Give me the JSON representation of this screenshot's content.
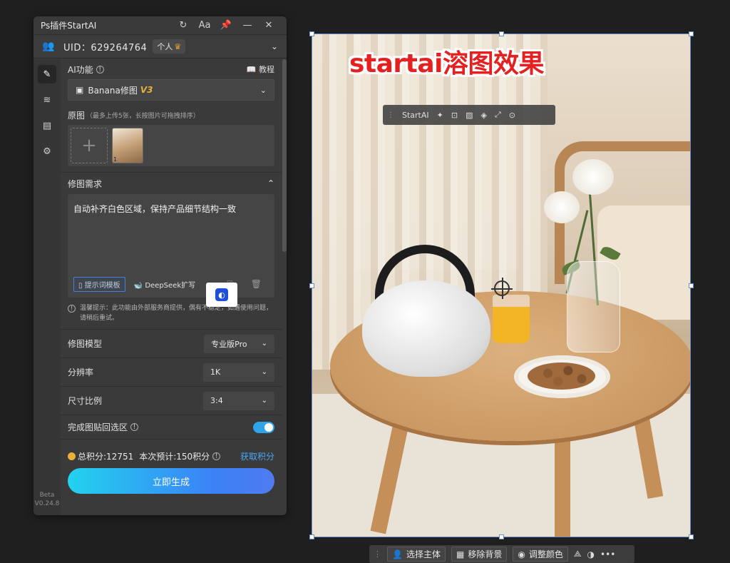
{
  "panel": {
    "title": "Ps插件StartAI",
    "title_icons": [
      "↻",
      "Aa",
      "📌",
      "—",
      "✕"
    ],
    "uid_label": "UID：629264764",
    "user_badge": "个人",
    "crown": "♛"
  },
  "sidebar": {
    "items": [
      "✎",
      "≋",
      "▤",
      "⚙"
    ],
    "version_line1": "Beta",
    "version_line2": "V0.24.8"
  },
  "ai_function": {
    "label": "AI功能",
    "tutorial": "📖 教程",
    "selected": "Banana修图",
    "version_tag": "V3"
  },
  "original_image": {
    "label": "原图",
    "hint": "（最多上传5张，长按图片可拖拽排序）",
    "add": "+",
    "thumb_index": "1"
  },
  "requirement": {
    "label": "修图需求",
    "text": "自动补齐白色区域，保持产品细节结构一致",
    "template_button": "提示词模板",
    "deepseek_button": "DeepSeek扩写",
    "tool_icons": "⎘ 🗑",
    "tip": "温馨提示：此功能由外部服务商提供，偶有不稳定，如遇使用问题，请稍后重试。"
  },
  "options": {
    "model_label": "修图模型",
    "model_value": "专业版Pro",
    "resolution_label": "分辨率",
    "resolution_value": "1K",
    "ratio_label": "尺寸比例",
    "ratio_value": "3:4",
    "paste_label": "完成图贴回选区",
    "paste_enabled": true
  },
  "footer": {
    "total_points": "总积分:12751",
    "estimate": "本次预计:150积分",
    "get_points": "获取积分",
    "generate": "立即生成"
  },
  "canvas": {
    "overlay_title": "startai溶图效果",
    "float_toolbar_label": "StartAI",
    "float_toolbar_icons": [
      "✦",
      "⊡",
      "▨",
      "◈",
      "⤢",
      "⊙"
    ]
  },
  "context_bar": {
    "select_subject": "选择主体",
    "remove_bg": "移除背景",
    "adjust_color": "调整颜色",
    "more": "•••"
  },
  "colors": {
    "panel_bg": "#3a3a3a",
    "accent_blue": "#4aa6f5",
    "gradient_start": "#22d3ee",
    "gradient_end": "#4f7bf0",
    "v3_gold": "#e8b23a",
    "title_red": "#e52020"
  }
}
